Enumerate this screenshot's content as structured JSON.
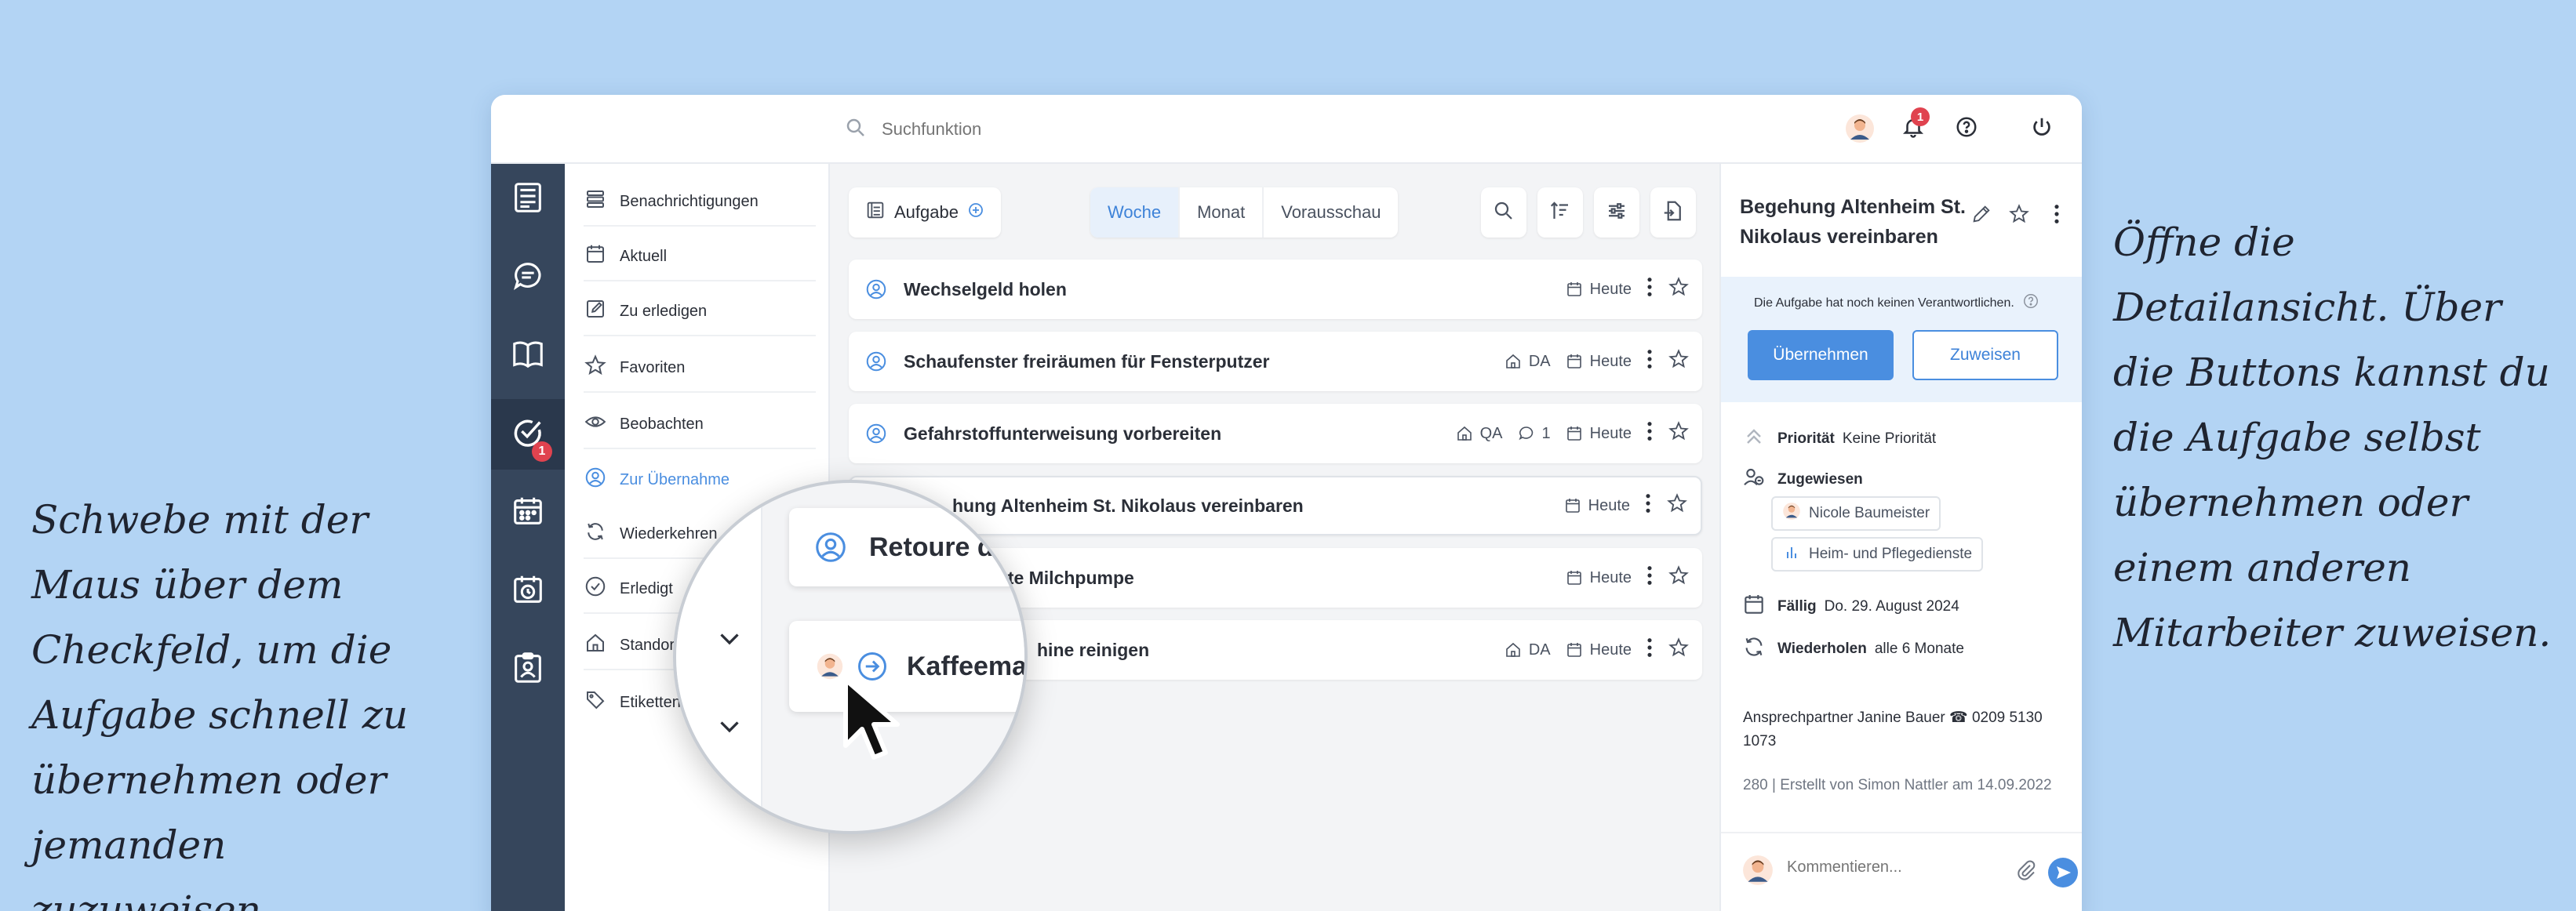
{
  "captions": {
    "left": "Schwebe mit der Maus über dem Checkfeld, um die Aufgabe schnell zu übernehmen oder jemanden zuzuweisen.",
    "right": "Öffne die Detailansicht. Über die Buttons kannst du die Aufgabe selbst übernehmen oder einem anderen Mitarbeiter zuweisen."
  },
  "topbar": {
    "search_placeholder": "Suchfunktion",
    "notification_count": "1"
  },
  "rail": {
    "tasks_badge": "1"
  },
  "subnav": {
    "items": [
      {
        "label": "Benachrichtigungen",
        "icon": "list-icon"
      },
      {
        "label": "Aktuell",
        "icon": "calendar-icon"
      },
      {
        "label": "Zu erledigen",
        "icon": "edit-icon"
      },
      {
        "label": "Favoriten",
        "icon": "star-icon"
      },
      {
        "label": "Beobachten",
        "icon": "eye-icon"
      },
      {
        "label": "Zur Übernahme",
        "icon": "user-icon"
      },
      {
        "label": "Wiederkehren",
        "icon": "repeat-icon"
      },
      {
        "label": "Erledigt",
        "icon": "check-icon"
      },
      {
        "label": "Standor",
        "icon": "home-icon"
      },
      {
        "label": "Etiketten",
        "icon": "tag-icon"
      }
    ]
  },
  "toolbar": {
    "new_label": "Aufgabe",
    "tabs": [
      "Woche",
      "Monat",
      "Vorausschau"
    ]
  },
  "tasks": [
    {
      "title": "Wechselgeld holen",
      "location": "",
      "comments": "",
      "due": "Heute"
    },
    {
      "title": "Schaufenster freiräumen für Fensterputzer",
      "location": "DA",
      "comments": "",
      "due": "Heute"
    },
    {
      "title": "Gefahrstoffunterweisung vorbereiten",
      "location": "QA",
      "comments": "1",
      "due": "Heute"
    },
    {
      "title": "hung Altenheim St. Nikolaus vereinbaren",
      "location": "",
      "comments": "",
      "due": "Heute"
    },
    {
      "title": "kte Milchpumpe",
      "location": "",
      "comments": "",
      "due": "Heute"
    },
    {
      "title": "hine reinigen",
      "location": "DA",
      "comments": "",
      "due": "Heute"
    }
  ],
  "magnifier": {
    "card1": "Retoure de",
    "card2": "Kaffeema"
  },
  "detail": {
    "title": "Begehung Altenheim St. Nikolaus vereinbaren",
    "note": "Die Aufgabe hat noch keinen Verantwortlichen.",
    "btn_take": "Übernehmen",
    "btn_assign": "Zuweisen",
    "priority_label": "Priorität",
    "priority_value": "Keine Priorität",
    "assigned_label": "Zugewiesen",
    "assignee_person": "Nicole Baumeister",
    "assignee_group": "Heim- und Pflegedienste",
    "due_label": "Fällig",
    "due_value": "Do. 29. August 2024",
    "repeat_label": "Wiederholen",
    "repeat_value": "alle 6 Monate",
    "contact_line1": "Ansprechpartner Janine Bauer ☎ 0209 5130",
    "contact_line2": "1073",
    "footer": "280 | Erstellt von Simon Nattler am 14.09.2022",
    "comment_placeholder": "Kommentieren..."
  },
  "colors": {
    "accent": "#4a8ee0",
    "rail": "#36465c",
    "badge": "#e0434f",
    "background": "#b3d4f4"
  }
}
